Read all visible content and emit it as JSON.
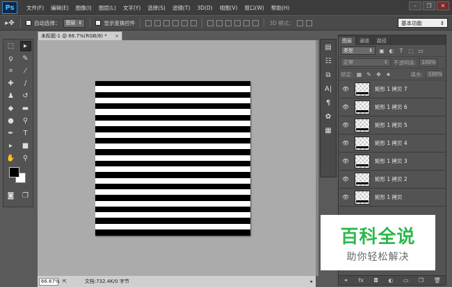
{
  "app": {
    "logo": "Ps"
  },
  "menubar": {
    "items": [
      "文件(F)",
      "编辑(E)",
      "图像(I)",
      "图层(L)",
      "文字(Y)",
      "选择(S)",
      "滤镜(T)",
      "3D(D)",
      "视图(V)",
      "窗口(W)",
      "帮助(H)"
    ]
  },
  "options": {
    "auto_select_label": "自动选择：",
    "auto_select_value": "图层",
    "show_transform_label": "显示变换控件",
    "mode_3d_label": "3D 模式：",
    "workspace": "基本功能"
  },
  "document": {
    "tab_title": "未标题-1 @ 66.7%(RGB/8) *",
    "zoom": "66.67%",
    "doc_info": "文档:732.4K/0 字节",
    "stripe_count": 13
  },
  "layers_panel": {
    "tabs": [
      "图层",
      "通道",
      "路径"
    ],
    "filter_kind": "类型",
    "blend_mode": "正常",
    "opacity_label": "不透明度:",
    "opacity_value": "100%",
    "lock_label": "锁定:",
    "fill_label": "填充:",
    "fill_value": "100%",
    "layers": [
      {
        "name": "矩形 1 拷贝 7"
      },
      {
        "name": "矩形 1 拷贝 6"
      },
      {
        "name": "矩形 1 拷贝 5"
      },
      {
        "name": "矩形 1 拷贝 4"
      },
      {
        "name": "矩形 1 拷贝 3"
      },
      {
        "name": "矩形 1 拷贝 2"
      },
      {
        "name": "矩形 1 拷贝"
      }
    ]
  },
  "watermark": {
    "line1": "百科全说",
    "line2": "助你轻松解决"
  },
  "colors": {
    "accent": "#2db84d",
    "canvas_bg": "#ababab"
  }
}
